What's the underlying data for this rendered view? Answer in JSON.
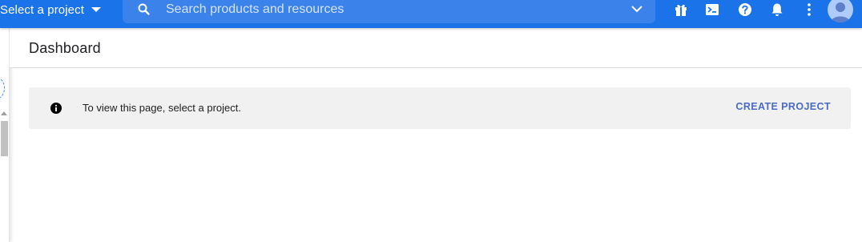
{
  "topbar": {
    "project_selector_label": "Select a project",
    "search_placeholder": "Search products and resources",
    "icons": [
      "gift-icon",
      "cloud-shell-icon",
      "help-icon",
      "notifications-icon",
      "more-vert-icon",
      "account-avatar"
    ]
  },
  "header": {
    "title": "Dashboard"
  },
  "banner": {
    "message": "To view this page, select a project.",
    "action_label": "CREATE PROJECT"
  },
  "colors": {
    "topbar": "#1a73e8",
    "search_bg": "#3b82ea",
    "banner_bg": "#f1f1f1",
    "action": "#4b6bc3"
  }
}
